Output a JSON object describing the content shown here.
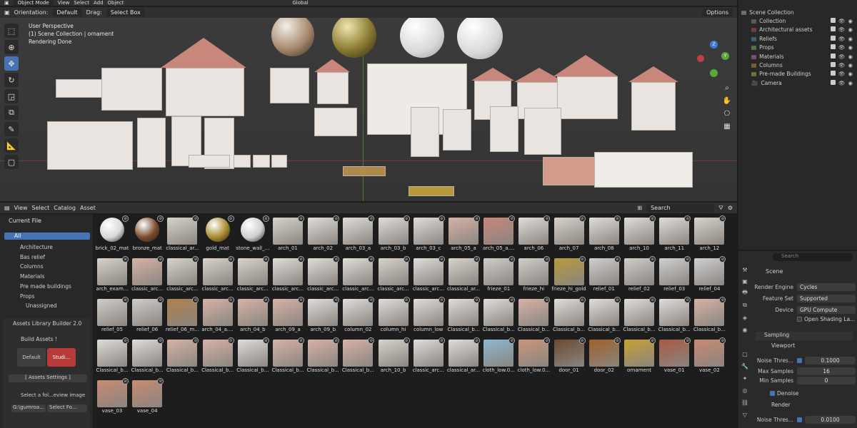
{
  "top": {
    "mode": "Object Mode",
    "menu": [
      "View",
      "Select",
      "Add",
      "Object"
    ],
    "transform": "Global",
    "options": "Options"
  },
  "toolbar2": {
    "orientation_label": "Orientation:",
    "orientation": "Default",
    "drag_label": "Drag:",
    "drag": "Select Box"
  },
  "viewport": {
    "line1": "User Perspective",
    "line2": "(1) Scene Collection | ornament",
    "line3": "Rendering Done",
    "axes": [
      "Z",
      "Y",
      "X"
    ]
  },
  "outliner": {
    "root": "Scene Collection",
    "items": [
      {
        "name": "Collection",
        "color": "#a0a0a0"
      },
      {
        "name": "Architectural assets",
        "color": "#d45b4e"
      },
      {
        "name": "Reliefs",
        "color": "#5ea8d8"
      },
      {
        "name": "Props",
        "color": "#8fd06e"
      },
      {
        "name": "Materials",
        "color": "#d88ad8"
      },
      {
        "name": "Columns",
        "color": "#e0a14a"
      },
      {
        "name": "Pre-made Buildings",
        "color": "#e2c84a"
      },
      {
        "name": "Camera",
        "color": "#8fbfe0"
      }
    ]
  },
  "browser": {
    "menu": [
      "View",
      "Select",
      "Catalog",
      "Asset"
    ],
    "search_placeholder": "Search",
    "library": "Current File",
    "catalog": [
      "All",
      "Architecture",
      "Bas relief",
      "Columns",
      "Materials",
      "Pre made buildings",
      "Props",
      "Unassigned"
    ],
    "builder": {
      "title": "Assets Library Builder 2.0",
      "build": "Build Assets !",
      "default": "Default",
      "studio": "Studi...",
      "settings": "[ Assets Settings ]",
      "select_folder": "Select a fol...eview image",
      "path": "G:\\gumroa...",
      "select_btn": "Select Fo..."
    },
    "assets": [
      {
        "n": "brick_02_mat",
        "c": "#d9d9d9",
        "s": 1
      },
      {
        "n": "bronze_mat",
        "c": "#7a4a2a",
        "s": 1
      },
      {
        "n": "classical_ar...",
        "c": "#d8d2cc"
      },
      {
        "n": "gold_mat",
        "c": "#a88a2a",
        "s": 1
      },
      {
        "n": "stone_wall_...",
        "c": "#cfcfcf",
        "s": 1
      },
      {
        "n": "arch_01",
        "c": "#d8d2cc"
      },
      {
        "n": "arch_02",
        "c": "#e0dcd8"
      },
      {
        "n": "arch_03_a",
        "c": "#e0dcd8"
      },
      {
        "n": "arch_03_b",
        "c": "#e0dcd8"
      },
      {
        "n": "arch_03_c",
        "c": "#e0dcd8"
      },
      {
        "n": "arch_05_a",
        "c": "#d7b2a6"
      },
      {
        "n": "arch_05_a....",
        "c": "#c9867a"
      },
      {
        "n": "arch_06",
        "c": "#e0dcd8"
      },
      {
        "n": "arch_07",
        "c": "#d8d2cc"
      },
      {
        "n": "arch_08",
        "c": "#e0dcd8"
      },
      {
        "n": "arch_10",
        "c": "#e0dcd8"
      },
      {
        "n": "arch_11",
        "c": "#e0dcd8"
      },
      {
        "n": "arch_12",
        "c": "#d8d2cc"
      },
      {
        "n": "arch_exam...",
        "c": "#d8d2cc"
      },
      {
        "n": "classic_arc...",
        "c": "#d7b2a6"
      },
      {
        "n": "classic_arc...",
        "c": "#d8d2cc"
      },
      {
        "n": "classic_arc...",
        "c": "#d8d2cc"
      },
      {
        "n": "classic_arc...",
        "c": "#d8d2cc"
      },
      {
        "n": "classic_arc...",
        "c": "#e0dcd8"
      },
      {
        "n": "classic_arc...",
        "c": "#e0dcd8"
      },
      {
        "n": "classic_arc...",
        "c": "#e0dcd8"
      },
      {
        "n": "classic_arc...",
        "c": "#d8d2cc"
      },
      {
        "n": "classic_arc...",
        "c": "#e0dcd8"
      },
      {
        "n": "classical_ar...",
        "c": "#d8d2cc"
      },
      {
        "n": "frieze_01",
        "c": "#d0ccc8"
      },
      {
        "n": "frieze_hi",
        "c": "#d0ccc8"
      },
      {
        "n": "frieze_hi_gold",
        "c": "#b89a3a"
      },
      {
        "n": "relief_01",
        "c": "#cfcfcf"
      },
      {
        "n": "relief_02",
        "c": "#d0ccc8"
      },
      {
        "n": "relief_03",
        "c": "#cfcfcf"
      },
      {
        "n": "relief_04",
        "c": "#cfcfcf"
      },
      {
        "n": "relief_05",
        "c": "#d0ccc8"
      },
      {
        "n": "relief_06",
        "c": "#d0ccc8"
      },
      {
        "n": "relief_06_m...",
        "c": "#b0804a"
      },
      {
        "n": "arch_04_a....",
        "c": "#d7b2a6"
      },
      {
        "n": "arch_04_b",
        "c": "#d7b2a6"
      },
      {
        "n": "arch_09_a",
        "c": "#d7b2a6"
      },
      {
        "n": "arch_09_b",
        "c": "#e0dcd8"
      },
      {
        "n": "column_02",
        "c": "#e0dcd8"
      },
      {
        "n": "column_hi",
        "c": "#e0dcd8"
      },
      {
        "n": "column_low",
        "c": "#e0dcd8"
      },
      {
        "n": "Classical_b...",
        "c": "#e0dcd8"
      },
      {
        "n": "Classical_b...",
        "c": "#e0dcd8"
      },
      {
        "n": "Classical_b...",
        "c": "#d7b2a6"
      },
      {
        "n": "Classical_b...",
        "c": "#e0dcd8"
      },
      {
        "n": "Classical_b...",
        "c": "#e0dcd8"
      },
      {
        "n": "Classical_b...",
        "c": "#e0dcd8"
      },
      {
        "n": "Classical_b...",
        "c": "#e0dcd8"
      },
      {
        "n": "Classical_b...",
        "c": "#d7b2a6"
      },
      {
        "n": "Classical_b...",
        "c": "#e0dcd8"
      },
      {
        "n": "Classical_b...",
        "c": "#e0dcd8"
      },
      {
        "n": "Classical_b...",
        "c": "#d7b2a6"
      },
      {
        "n": "Classical_b...",
        "c": "#d7b2a6"
      },
      {
        "n": "Classical_b...",
        "c": "#e0dcd8"
      },
      {
        "n": "Classical_b...",
        "c": "#d7b2a6"
      },
      {
        "n": "Classical_b...",
        "c": "#d7b2a6"
      },
      {
        "n": "Classical_b...",
        "c": "#d7b2a6"
      },
      {
        "n": "arch_10_b",
        "c": "#d8d2cc"
      },
      {
        "n": "classic_arc...",
        "c": "#e0dcd8"
      },
      {
        "n": "classical_ar...",
        "c": "#e0dcd8"
      },
      {
        "n": "cloth_low.0...",
        "c": "#8cb8d0"
      },
      {
        "n": "cloth_low.0...",
        "c": "#c9967a"
      },
      {
        "n": "door_01",
        "c": "#6a4a30"
      },
      {
        "n": "door_02",
        "c": "#a0602a"
      },
      {
        "n": "ornament",
        "c": "#c8a030"
      },
      {
        "n": "vase_01",
        "c": "#a85a42"
      },
      {
        "n": "vase_02",
        "c": "#c98a72"
      },
      {
        "n": "vase_03",
        "c": "#c98a72"
      },
      {
        "n": "vase_04",
        "c": "#c98a72"
      }
    ]
  },
  "props": {
    "search_placeholder": "Search",
    "scene": "Scene",
    "render_engine_label": "Render Engine",
    "render_engine": "Cycles",
    "feature_set_label": "Feature Set",
    "feature_set": "Supported",
    "device_label": "Device",
    "device": "GPU Compute",
    "osl": "Open Shading La...",
    "sampling": "Sampling",
    "viewport": "Viewport",
    "noise_label": "Noise Thres...",
    "noise": "0.1000",
    "max_samples_label": "Max Samples",
    "max_samples": "16",
    "min_samples_label": "Min Samples",
    "min_samples": "0",
    "denoise": "Denoise",
    "render": "Render",
    "noise2_label": "Noise Thres...",
    "noise2": "0.0100"
  }
}
